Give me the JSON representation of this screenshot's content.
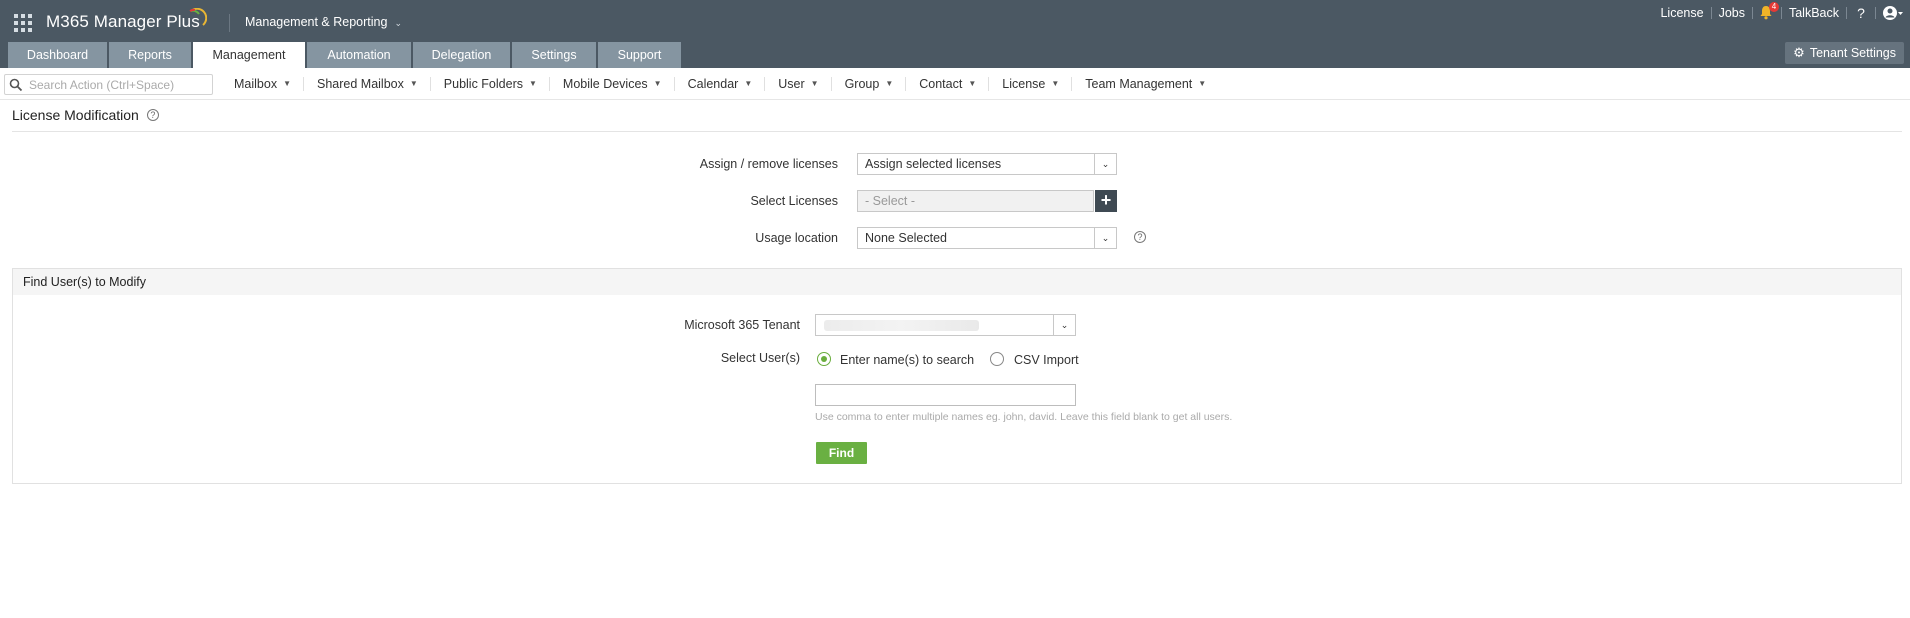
{
  "header": {
    "app_title": "M365 Manager Plus",
    "module_switcher": "Management & Reporting",
    "links": {
      "license": "License",
      "jobs": "Jobs",
      "talkback": "TalkBack",
      "help": "?"
    },
    "notification_count": "4"
  },
  "tabs": [
    {
      "label": "Dashboard"
    },
    {
      "label": "Reports"
    },
    {
      "label": "Management",
      "active": true
    },
    {
      "label": "Automation"
    },
    {
      "label": "Delegation"
    },
    {
      "label": "Settings"
    },
    {
      "label": "Support"
    }
  ],
  "tenant_settings": "Tenant Settings",
  "search": {
    "placeholder": "Search Action (Ctrl+Space)"
  },
  "submenu": [
    {
      "label": "Mailbox"
    },
    {
      "label": "Shared Mailbox"
    },
    {
      "label": "Public Folders"
    },
    {
      "label": "Mobile Devices"
    },
    {
      "label": "Calendar"
    },
    {
      "label": "User"
    },
    {
      "label": "Group"
    },
    {
      "label": "Contact"
    },
    {
      "label": "License"
    },
    {
      "label": "Team Management"
    }
  ],
  "page": {
    "title": "License Modification"
  },
  "form": {
    "assign_label": "Assign / remove licenses",
    "assign_value": "Assign selected licenses",
    "select_licenses_label": "Select Licenses",
    "select_licenses_value": "- Select -",
    "usage_location_label": "Usage location",
    "usage_location_value": "None Selected"
  },
  "find_panel": {
    "title": "Find User(s) to Modify",
    "tenant_label": "Microsoft 365 Tenant",
    "select_users_label": "Select User(s)",
    "radio_options": [
      {
        "label": "Enter name(s) to search",
        "checked": true
      },
      {
        "label": "CSV Import",
        "checked": false
      }
    ],
    "names_value": "",
    "hint": "Use comma to enter multiple names eg. john, david. Leave this field blank to get all users.",
    "find_button": "Find"
  },
  "colors": {
    "header_bg": "#4b5863",
    "tab_bg": "#8595a1",
    "accent_green": "#6ab042",
    "plus_button": "#3f4a53"
  }
}
